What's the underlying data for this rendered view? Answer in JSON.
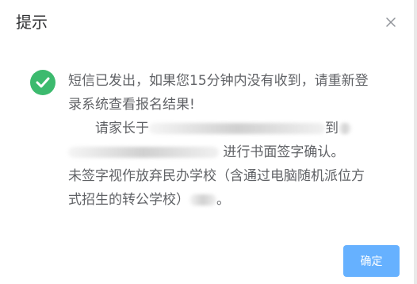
{
  "dialog": {
    "title": "提示",
    "close_icon": "close-icon",
    "status_icon": "success-check-icon",
    "message": {
      "line1": "短信已发出，如果您15分钟内没有收到，请重新登录系统查看报名结果!",
      "line2_prefix": "请家长于",
      "line2_mid": "到",
      "line3_suffix": "进行书面签字确认。",
      "line4": "未签字视作放弃民办学校（含通过电脑随机派位方式招生的转公学校）",
      "line4_end": "。"
    },
    "confirm_label": "确定"
  },
  "colors": {
    "success": "#3cba6e",
    "primary_button": "#66b1ff",
    "text": "#606266",
    "title": "#303133"
  }
}
